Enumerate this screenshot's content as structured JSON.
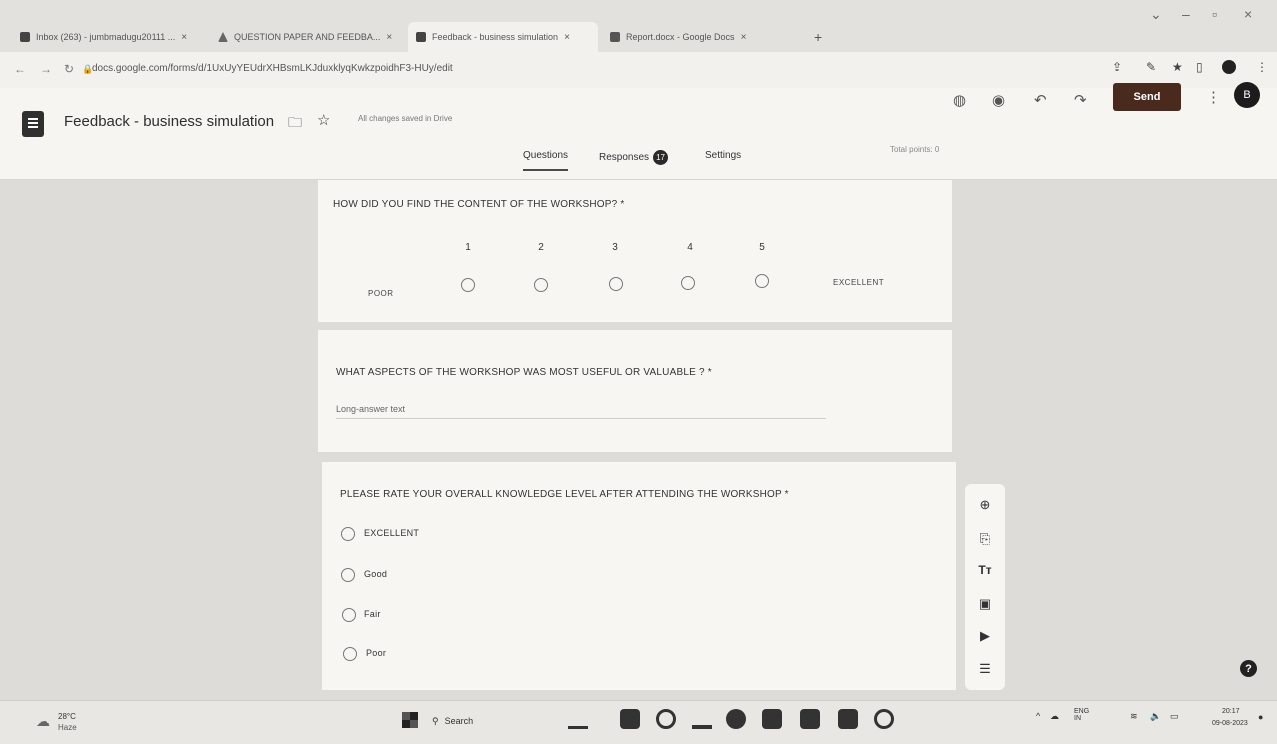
{
  "browser": {
    "tabs": [
      {
        "label": "Inbox (263) - jumbmadugu20111 ...",
        "icon": "mail-icon"
      },
      {
        "label": "QUESTION PAPER AND FEEDBA...",
        "icon": "drive-icon"
      },
      {
        "label": "Feedback - business simulation",
        "icon": "forms-icon",
        "active": true
      },
      {
        "label": "Report.docx - Google Docs",
        "icon": "docs-icon"
      }
    ],
    "new_tab_label": "+",
    "url": "docs.google.com/forms/d/1UxUyYEUdrXHBsmLKJduxklyqKwkzpoidhF3-HUy/edit"
  },
  "forms_header": {
    "title": "Feedback - business simulation",
    "saved_status": "All changes saved in Drive",
    "send_label": "Send",
    "avatar_initial": "B",
    "tabs": {
      "questions": "Questions",
      "responses": "Responses",
      "responses_count": "17",
      "settings": "Settings"
    },
    "total_points": "Total points: 0"
  },
  "questions": [
    {
      "title": "HOW DID YOU FIND THE CONTENT OF THE WORKSHOP? *",
      "type": "linear-scale",
      "scale": [
        "1",
        "2",
        "3",
        "4",
        "5"
      ],
      "low_label": "POOR",
      "high_label": "EXCELLENT"
    },
    {
      "title": "WHAT ASPECTS OF THE WORKSHOP WAS MOST USEFUL OR VALUABLE ? *",
      "type": "paragraph",
      "placeholder": "Long-answer text"
    },
    {
      "title": "PLEASE RATE YOUR OVERALL KNOWLEDGE LEVEL AFTER  ATTENDING THE WORKSHOP *",
      "type": "multiple-choice",
      "options": [
        "EXCELLENT",
        "Good",
        "Fair",
        "Poor"
      ]
    }
  ],
  "toolbar_icons": [
    "add-question-icon",
    "import-questions-icon",
    "add-title-icon",
    "add-image-icon",
    "add-video-icon",
    "add-section-icon"
  ],
  "taskbar": {
    "weather_temp": "28°C",
    "weather_desc": "Haze",
    "search_label": "Search",
    "lang_line1": "ENG",
    "lang_line2": "IN",
    "time": "20:17",
    "date": "09-08-2023"
  }
}
